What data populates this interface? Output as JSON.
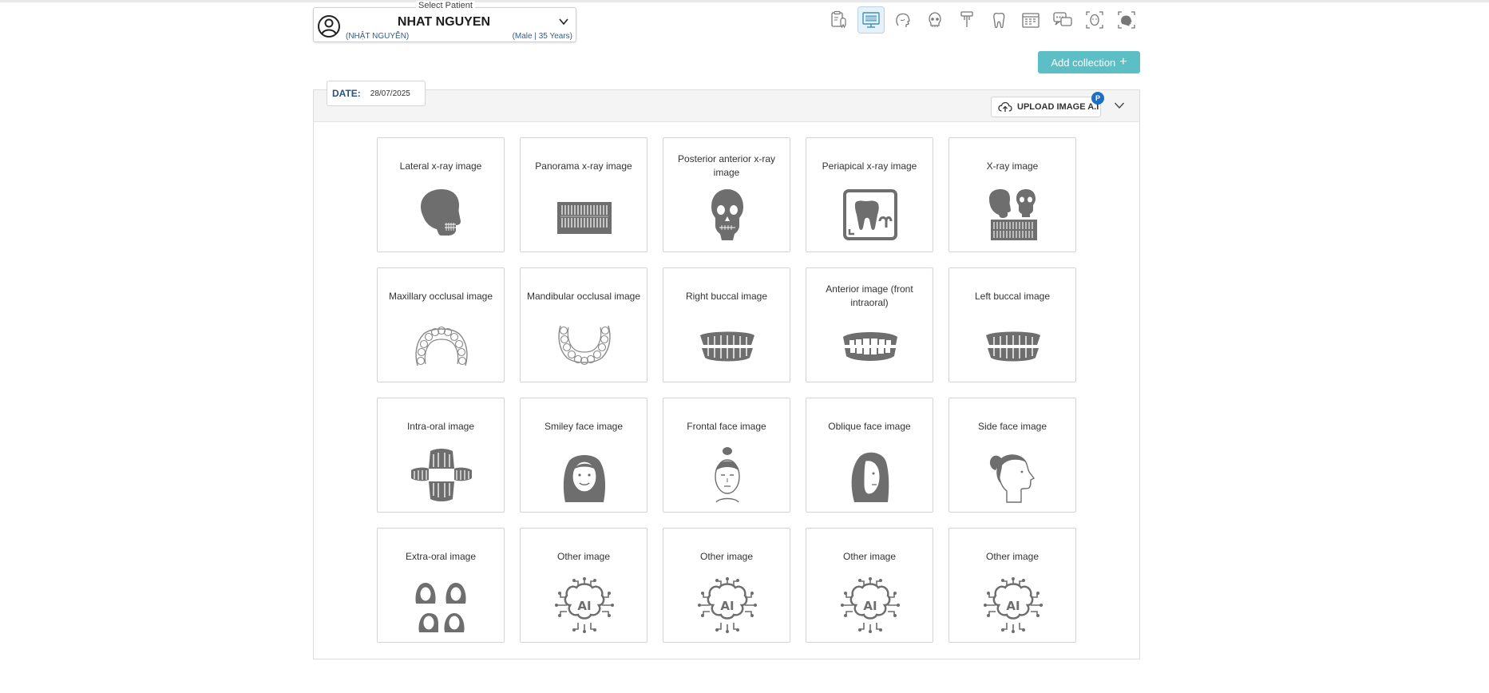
{
  "patient": {
    "legend": "Select Patient",
    "name": "NHAT NGUYEN",
    "subname": "(NHẬT NGUYỄN)",
    "info": "(Male | 35 Years)"
  },
  "toolbar": {
    "items": [
      {
        "icon": "clipboard-teeth-icon",
        "active": false
      },
      {
        "icon": "monitor-xray-icon",
        "active": true
      },
      {
        "icon": "head-profile-icon",
        "active": false
      },
      {
        "icon": "skull-icon",
        "active": false
      },
      {
        "icon": "dental-tool-icon",
        "active": false
      },
      {
        "icon": "tooth-icon",
        "active": false
      },
      {
        "icon": "calendar-icon",
        "active": false
      },
      {
        "icon": "chat-icon",
        "active": false
      },
      {
        "icon": "face-scan-icon",
        "active": false
      },
      {
        "icon": "head-scan-icon",
        "active": false
      }
    ]
  },
  "actions": {
    "add_collection": "Add collection",
    "add_collection_icon": "+"
  },
  "date": {
    "label": "DATE:",
    "value": "28/07/2025"
  },
  "upload": {
    "label": "UPLOAD IMAGE A.I",
    "badge": "P"
  },
  "cards": [
    {
      "label": "Lateral x-ray image",
      "icon": "skull-lateral-icon"
    },
    {
      "label": "Panorama x-ray image",
      "icon": "panorama-xray-icon"
    },
    {
      "label": "Posterior anterior x-ray image",
      "icon": "skull-front-icon"
    },
    {
      "label": "Periapical x-ray image",
      "icon": "periapical-tooth-icon"
    },
    {
      "label": "X-ray image",
      "icon": "xray-collage-icon"
    },
    {
      "label": "Maxillary occlusal image",
      "icon": "maxillary-arch-icon"
    },
    {
      "label": "Mandibular occlusal image",
      "icon": "mandibular-arch-icon"
    },
    {
      "label": "Right buccal image",
      "icon": "buccal-teeth-icon"
    },
    {
      "label": "Anterior image (front intraoral)",
      "icon": "anterior-teeth-icon"
    },
    {
      "label": "Left buccal image",
      "icon": "buccal-teeth-icon"
    },
    {
      "label": "Intra-oral image",
      "icon": "open-mouth-teeth-icon"
    },
    {
      "label": "Smiley face image",
      "icon": "smiley-face-icon"
    },
    {
      "label": "Frontal face image",
      "icon": "frontal-face-icon"
    },
    {
      "label": "Oblique face image",
      "icon": "oblique-face-icon"
    },
    {
      "label": "Side face image",
      "icon": "side-face-icon"
    },
    {
      "label": "Extra-oral image",
      "icon": "group-faces-icon"
    },
    {
      "label": "Other image",
      "icon": "ai-brain-icon"
    },
    {
      "label": "Other image",
      "icon": "ai-brain-icon"
    },
    {
      "label": "Other image",
      "icon": "ai-brain-icon"
    },
    {
      "label": "Other image",
      "icon": "ai-brain-icon"
    }
  ],
  "colors": {
    "accent": "#5bbfc5",
    "badge": "#1d6fc4",
    "label_blue": "#2b5277",
    "icon_gray": "#6e6e6e"
  }
}
